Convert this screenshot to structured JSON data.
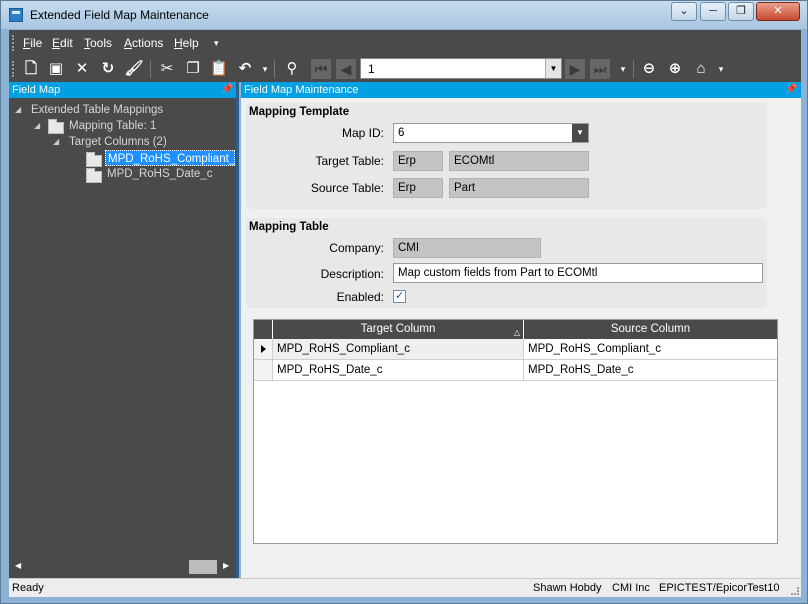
{
  "window": {
    "title": "Extended Field Map Maintenance",
    "controls": {
      "minimize": "─",
      "restore": "❐",
      "close": "✕",
      "extra": "⌄"
    }
  },
  "menu": {
    "items": [
      "File",
      "Edit",
      "Tools",
      "Actions",
      "Help"
    ],
    "mnemonics": [
      "F",
      "E",
      "T",
      "A",
      "H"
    ],
    "more": "▾"
  },
  "toolbar": {
    "nav_value": "1",
    "icons": [
      "new-icon",
      "save-icon",
      "delete-icon",
      "refresh-icon",
      "clear-icon",
      "cut-icon",
      "copy-icon",
      "paste-icon",
      "undo-icon",
      "search-icon",
      "first-icon",
      "previous-icon",
      "next-icon",
      "last-icon",
      "back-icon",
      "forward-icon",
      "home-icon"
    ]
  },
  "left_panel": {
    "title": "Field Map",
    "tree": {
      "root": "Extended Table Mappings",
      "mapping_table": "Mapping Table: 1",
      "target_columns": "Target Columns (2)",
      "columns": [
        "MPD_RoHS_Compliant_",
        "MPD_RoHS_Date_c"
      ]
    }
  },
  "right_panel": {
    "title": "Field Map Maintenance",
    "mapping_template": {
      "title": "Mapping Template",
      "map_id_label": "Map ID:",
      "map_id_value": "6",
      "target_table_label": "Target Table:",
      "target_table_db": "Erp",
      "target_table_name": "ECOMtl",
      "source_table_label": "Source Table:",
      "source_table_db": "Erp",
      "source_table_name": "Part"
    },
    "mapping_table": {
      "title": "Mapping Table",
      "company_label": "Company:",
      "company_value": "CMI",
      "description_label": "Description:",
      "description_value": "Map custom fields from Part to ECOMtl",
      "enabled_label": "Enabled:",
      "enabled_mark": "✓"
    },
    "grid": {
      "headers": [
        "Target Column",
        "Source Column"
      ],
      "rows": [
        [
          "MPD_RoHS_Compliant_c",
          "MPD_RoHS_Compliant_c"
        ],
        [
          "MPD_RoHS_Date_c",
          "MPD_RoHS_Date_c"
        ]
      ]
    }
  },
  "status": {
    "state": "Ready",
    "user": "Shawn Hobdy",
    "company": "CMI Inc",
    "environment": "EPICTEST/EpicorTest10"
  },
  "colors": {
    "panel_header": "#00a0e3",
    "toolbar_bg": "#4a4a4a",
    "selection": "#1e90ff"
  }
}
